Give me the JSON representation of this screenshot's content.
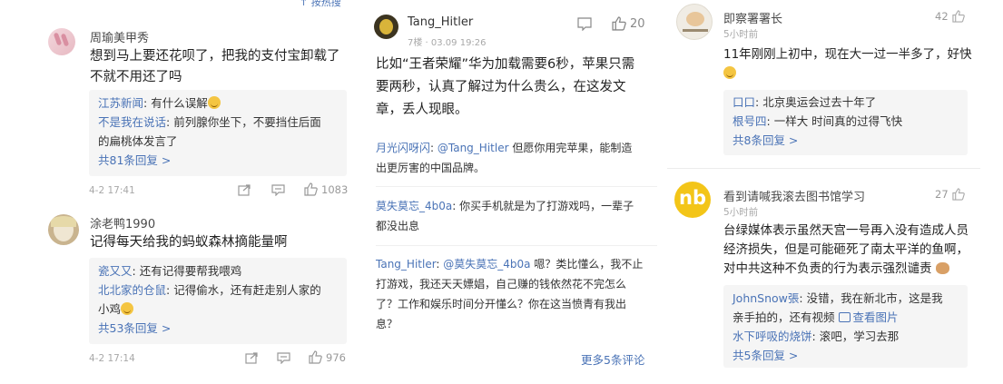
{
  "left": {
    "top_clip": "↑ 按热搜",
    "c1": {
      "user": "周瑜美甲秀",
      "text_lines": [
        "想到马上要还花呗了，把我的支付宝卸载了",
        "不就不用还了吗"
      ],
      "replies": [
        {
          "name": "江苏新闻",
          "text": "有什么误解"
        },
        {
          "name": "不是我在说话",
          "text": "前列腺你坐下，不要挡住后面",
          "text2": "的扁桃体发言了"
        }
      ],
      "more": "共81条回复 >",
      "time": "4-2 17:41",
      "likes": "1083"
    },
    "c2": {
      "user": "涂老鸭1990",
      "text_lines": [
        "记得每天给我的蚂蚁森林摘能量啊"
      ],
      "replies": [
        {
          "name": "瓷又又",
          "text": "还有记得要帮我喂鸡"
        },
        {
          "name": "北北家的仓鼠",
          "text": "记得偷水，还有赶走别人家的",
          "text2": "小鸡"
        }
      ],
      "more": "共53条回复 >",
      "time": "4-2 17:14",
      "likes": "976"
    }
  },
  "mid": {
    "user": "Tang_Hitler",
    "meta": "7楼 · 03.09 19:26",
    "likes": "20",
    "text_lines": [
      "比如“王者荣耀”华为加载需要6秒，苹果只需",
      "要两秒，认真了解过为什么贵么，在这发文",
      "章，丢人现眼。"
    ],
    "replies": [
      {
        "name": "月光闪呀闪",
        "mention": "@Tang_Hitler",
        "line1": "但愿你用完苹果，能制造",
        "line2": "出更厉害的中国品牌。"
      },
      {
        "name": "莫失莫忘_4b0a",
        "mention": "",
        "line1": "你买手机就是为了打游戏吗，一辈子",
        "line2": "都没出息"
      },
      {
        "name": "Tang_Hitler",
        "mention": "@莫失莫忘_4b0a",
        "line1": "嗯？类比懂么，我不止",
        "line2": "打游戏，我还天天嫖娼，自己赚的钱依然花不完怎么",
        "line3": "了？工作和娱乐时间分开懂么？你在这当愤青有我出",
        "line4": "息？"
      }
    ],
    "more": "更多5条评论"
  },
  "right": {
    "c1": {
      "user": "即察署署长",
      "meta": "5小时前",
      "likes": "42",
      "text": "11年刚刚上初中，现在大一过一半多了，好快",
      "replies": [
        {
          "name": "口口",
          "text": "北京奥运会过去十年了"
        },
        {
          "name": "根号四",
          "text": "一样大 时间真的过得飞快"
        }
      ],
      "more": "共8条回复 >"
    },
    "c2": {
      "user": "看到请喊我滚去图书馆学习",
      "meta": "5小时前",
      "likes": "27",
      "avatar_text": "nb",
      "text_lines": [
        "台绿媒体表示虽然天宫一号再入没有造成人员",
        "经济损失，但是可能砸死了南太平洋的鱼啊，",
        "对中共这种不负责的行为表示强烈谴责"
      ],
      "replies": [
        {
          "name": "JohnSnow張",
          "text": "没错，我在新北市，这是我",
          "text2": "亲手拍的，还有视频",
          "link": "查看图片"
        },
        {
          "name": "水下呼吸的烧饼",
          "text": "滚吧，学习去那"
        }
      ],
      "more": "共5条回复 >"
    }
  },
  "colors": {
    "link": "#4a73b6",
    "reply_bg": "#f5f5f5",
    "meta": "#a8a8a8"
  }
}
